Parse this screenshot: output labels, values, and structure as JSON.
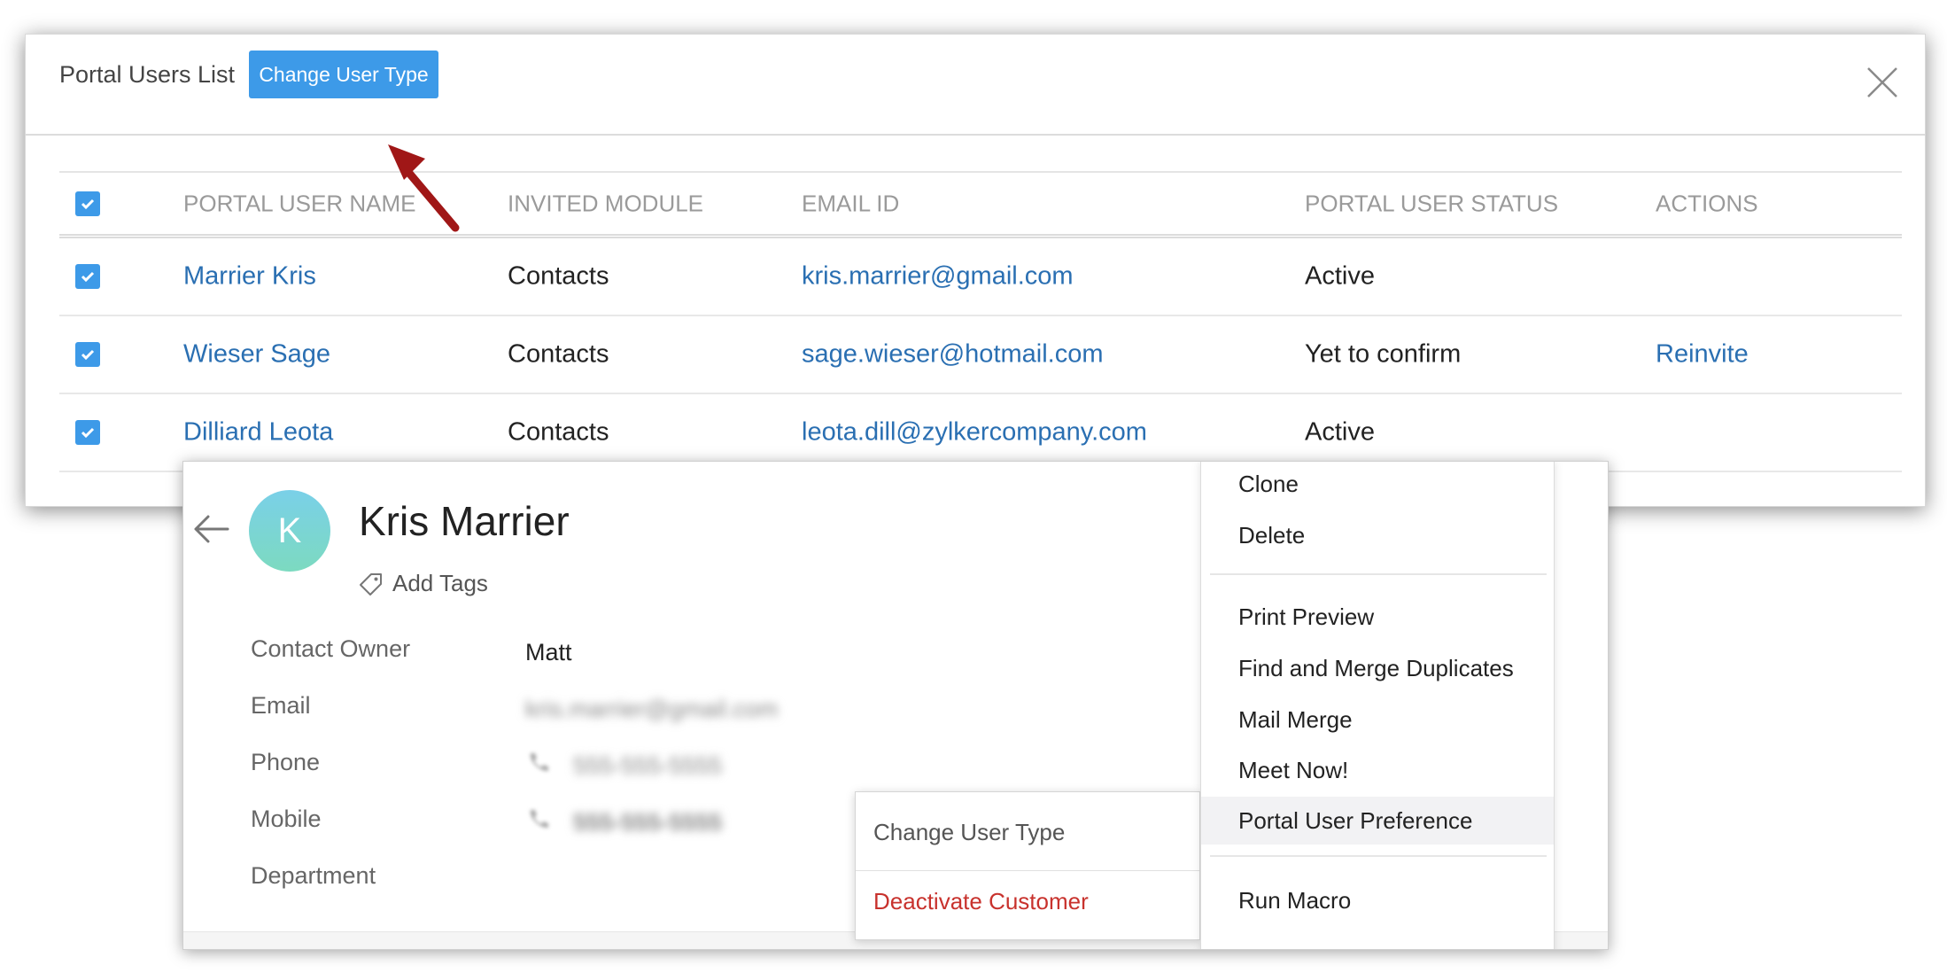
{
  "modal": {
    "title": "Portal Users List",
    "change_type_button": "Change User Type",
    "columns": [
      "PORTAL USER NAME",
      "INVITED MODULE",
      "EMAIL ID",
      "PORTAL USER STATUS",
      "ACTIONS"
    ],
    "rows": [
      {
        "name": "Marrier Kris",
        "module": "Contacts",
        "email": "kris.marrier@gmail.com",
        "status": "Active",
        "action": "toggle-on"
      },
      {
        "name": "Wieser Sage",
        "module": "Contacts",
        "email": "sage.wieser@hotmail.com",
        "status": "Yet to confirm",
        "action": "Reinvite"
      },
      {
        "name": "Dilliard Leota",
        "module": "Contacts",
        "email": "leota.dill@zylkercompany.com",
        "status": "Active",
        "action": "toggle-on"
      }
    ]
  },
  "contact": {
    "avatar_initial": "K",
    "name": "Kris Marrier",
    "add_tags": "Add Tags",
    "fields": [
      {
        "label": "Contact Owner",
        "value": "Matt"
      },
      {
        "label": "Email",
        "value": "kris.marrier@gmail.com"
      },
      {
        "label": "Phone",
        "value": "555-555-5555"
      },
      {
        "label": "Mobile",
        "value": "555-555-5555"
      },
      {
        "label": "Department",
        "value": ""
      }
    ]
  },
  "submenu": {
    "items": [
      "Change User Type",
      "Deactivate Customer"
    ]
  },
  "menu": {
    "items": [
      "Clone",
      "Delete",
      "Print Preview",
      "Find and Merge Duplicates",
      "Mail Merge",
      "Meet Now!",
      "Portal User Preference",
      "Run Macro"
    ],
    "highlighted": "Portal User Preference"
  },
  "colors": {
    "primary": "#3d9ae8",
    "link": "#2a6fb2",
    "toggle_on": "#5cbc74",
    "danger": "#c8322d",
    "arrow": "#a01717"
  }
}
